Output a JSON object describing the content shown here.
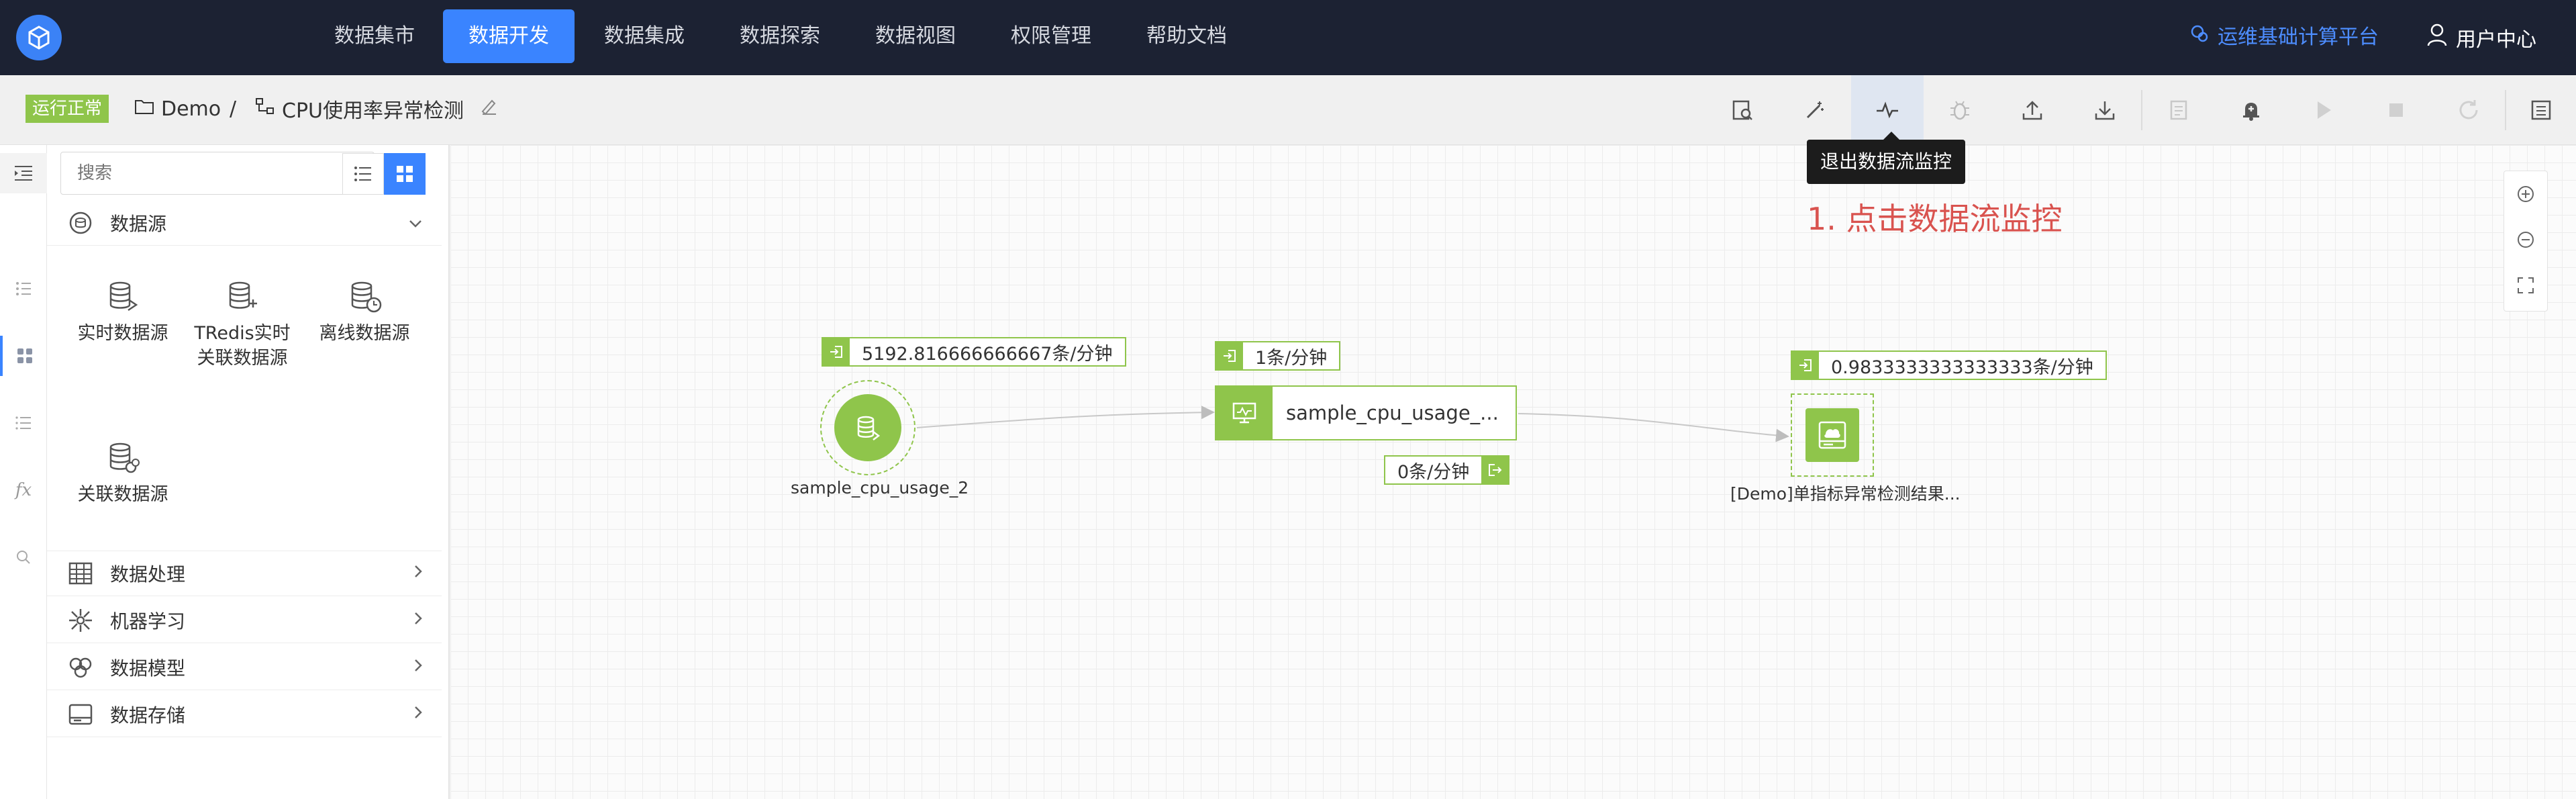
{
  "nav": {
    "items": [
      "数据集市",
      "数据开发",
      "数据集成",
      "数据探索",
      "数据视图",
      "权限管理",
      "帮助文档"
    ],
    "active_index": 1,
    "platform": "运维基础计算平台",
    "user": "用户中心"
  },
  "toolbar": {
    "status": "运行正常",
    "project": "Demo",
    "separator": "/",
    "flow_name": "CPU使用率异常检测"
  },
  "sidebar": {
    "search_placeholder": "搜索",
    "sections": {
      "datasource": "数据源",
      "processing": "数据处理",
      "ml": "机器学习",
      "model": "数据模型",
      "storage": "数据存储"
    },
    "datasources": [
      "实时数据源",
      "TRedis实时关联数据源",
      "离线数据源",
      "关联数据源"
    ]
  },
  "canvas": {
    "tooltip": "退出数据流监控",
    "annotation": "1. 点击数据流监控",
    "source_node": {
      "label": "sample_cpu_usage_2",
      "rate_out": "5192.816666666667条/分钟"
    },
    "process_node": {
      "label": "sample_cpu_usage_...",
      "rate_in": "1条/分钟",
      "rate_drop": "0条/分钟"
    },
    "sink_node": {
      "label": "[Demo]单指标异常检测结果...",
      "rate_in": "0.9833333333333333条/分钟"
    }
  },
  "colors": {
    "nav_bg": "#1c2233",
    "accent": "#3a84ff",
    "node_green": "#8fc54b",
    "annotation_red": "#d9534f"
  }
}
